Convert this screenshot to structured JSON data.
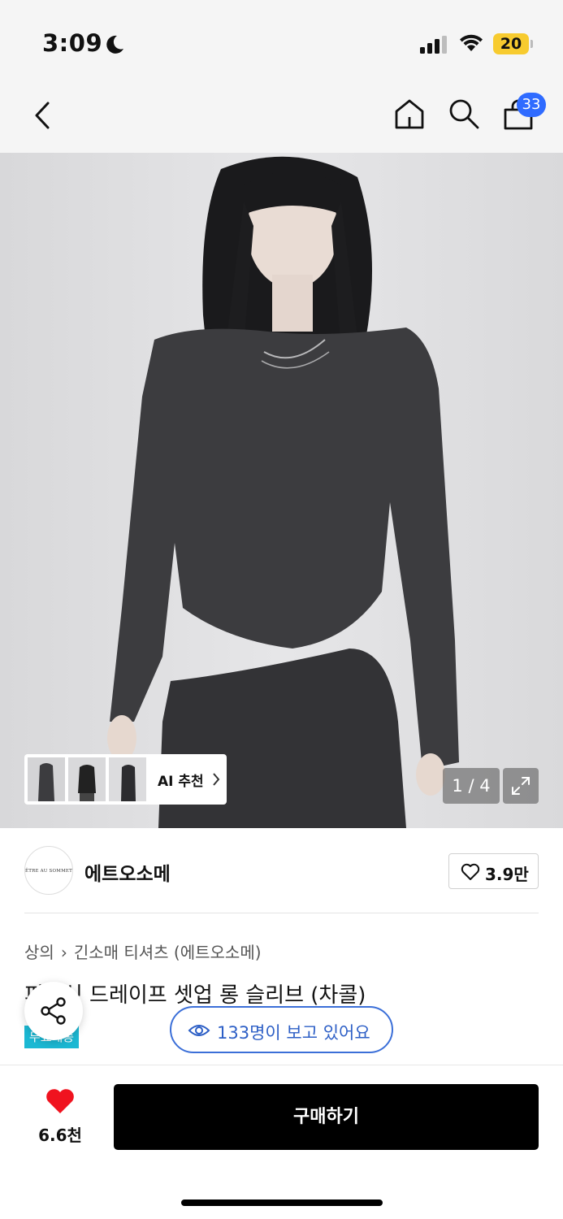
{
  "status_bar": {
    "time": "3:09",
    "battery": "20",
    "battery_color": "#f7cb2f"
  },
  "nav": {
    "cart_count": "33",
    "badge_color": "#2f6bff"
  },
  "gallery": {
    "ai_recommend_label": "AI 추천",
    "page_indicator": "1 / 4"
  },
  "brand": {
    "logo_text": "ÊTRE AU SOMMET",
    "name": "에트오소메",
    "like_count": "3.9만"
  },
  "product": {
    "category_main": "상의",
    "category_sub": "긴소매 티셔츠 (에트오소메)",
    "title": "피어싱 드레이프 셋업 롱 슬리브 (차콜)",
    "tag": "무료배송",
    "tag_color": "#1bb8d3"
  },
  "viewers": {
    "text": "133명이 보고 있어요",
    "accent": "#3b6fd8"
  },
  "bottom": {
    "wish_count": "6.6천",
    "heart_color": "#f0131f",
    "buy_label": "구매하기"
  }
}
